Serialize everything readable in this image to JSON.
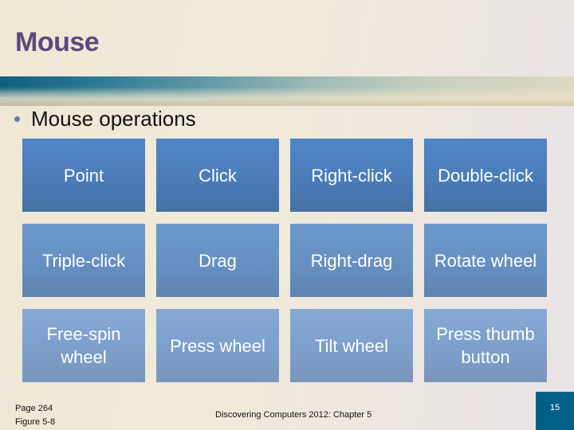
{
  "slide": {
    "title": "Mouse",
    "bullet": "Mouse operations",
    "operations": [
      [
        "Point",
        "Click",
        "Right-click",
        "Double-click"
      ],
      [
        "Triple-click",
        "Drag",
        "Right-drag",
        "Rotate wheel"
      ],
      [
        "Free-spin wheel",
        "Press wheel",
        "Tilt wheel",
        "Press thumb button"
      ]
    ],
    "colors": {
      "title": "#5a4a7f",
      "band_start": "#0e5e7e",
      "row_1_box": "#4a7bb7",
      "row_2_box": "#6690c2",
      "row_3_box": "#7c9fcc",
      "page_number_box": "#005f86"
    }
  },
  "footer": {
    "page_ref": "Page 264",
    "figure_ref": "Figure 5-8",
    "course": "Discovering Computers 2012: Chapter 5",
    "slide_number": "15"
  }
}
